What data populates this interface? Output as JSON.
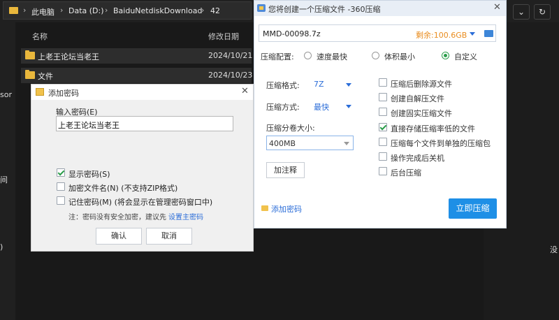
{
  "explorer": {
    "breadcrumb": [
      "此电脑",
      "Data (D:)",
      "BaiduNetdiskDownload",
      "42"
    ],
    "columns": {
      "name": "名称",
      "modified": "修改日期"
    },
    "rows": [
      {
        "name": "上老王论坛当老王",
        "date": "2024/10/21"
      },
      {
        "name": "文件",
        "date": "2024/10/23"
      }
    ],
    "side_fragments": {
      "left1": "sor",
      "left2": "间",
      "left3": ")",
      "right1": "没"
    }
  },
  "compress_dialog": {
    "title": "您将创建一个压缩文件 -360压缩",
    "filename": "MMD-00098.7z",
    "remaining": "剩余:100.6GB",
    "config_label": "压缩配置:",
    "config_options": [
      "速度最快",
      "体积最小",
      "自定义"
    ],
    "format_label": "压缩格式:",
    "format_value": "7Z",
    "method_label": "压缩方式:",
    "method_value": "最快",
    "volume_label": "压缩分卷大小:",
    "volume_value": "400MB",
    "comment_button": "加注释",
    "options": [
      {
        "label": "压缩后删除源文件",
        "checked": false
      },
      {
        "label": "创建自解压文件",
        "checked": false
      },
      {
        "label": "创建固实压缩文件",
        "checked": false
      },
      {
        "label": "直接存储压缩率低的文件",
        "checked": true
      },
      {
        "label": "压缩每个文件到单独的压缩包",
        "checked": false
      },
      {
        "label": "操作完成后关机",
        "checked": false
      },
      {
        "label": "后台压缩",
        "checked": false
      }
    ],
    "add_password_link": "添加密码",
    "start_button": "立即压缩"
  },
  "password_dialog": {
    "title": "添加密码",
    "input_label": "输入密码(E)",
    "password_value": "上老王论坛当老王",
    "options": [
      {
        "label": "显示密码(S)",
        "checked": true
      },
      {
        "label": "加密文件名(N) (不支持ZIP格式)",
        "checked": false
      },
      {
        "label": "记住密码(M) (将会显示在管理密码窗口中)",
        "checked": false
      }
    ],
    "note_prefix": "注：密码没有安全加密，建议先",
    "note_link": "设置主密码",
    "ok_button": "确认",
    "cancel_button": "取消"
  },
  "colors": {
    "accent": "#1e8fe6",
    "link": "#2b6dd8",
    "remaining": "#e98c1e",
    "check": "#2a9d4a"
  }
}
